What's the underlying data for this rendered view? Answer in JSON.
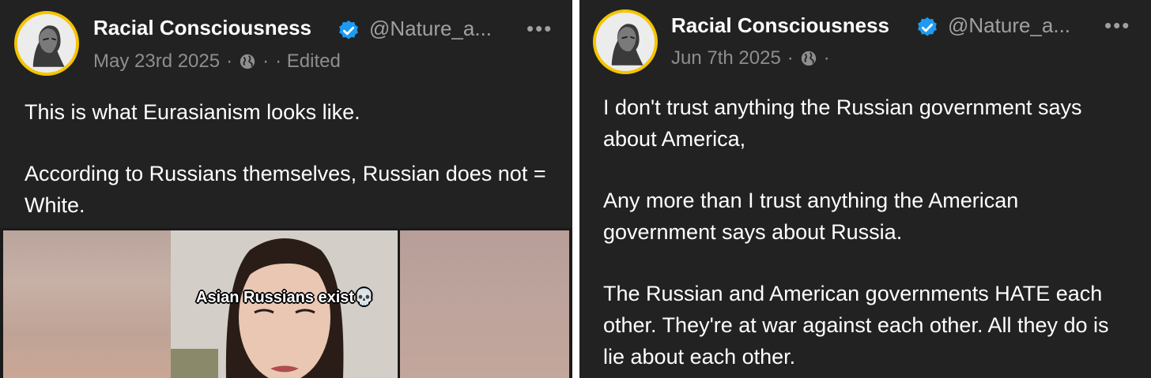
{
  "left_post": {
    "author_name": "Racial Consciousness",
    "handle": "@Nature_a...",
    "more_label": "•••",
    "date": "May 23rd 2025",
    "separator": "·",
    "edited_label": "· Edited",
    "paragraphs": [
      "This is what Eurasianism looks like.",
      "According to Russians themselves, Russian does not = White."
    ],
    "media_caption": "Asian Russians exist💀"
  },
  "right_post": {
    "author_name": "Racial Consciousness",
    "handle": "@Nature_a...",
    "more_label": "•••",
    "date": "Jun 7th 2025",
    "separator": "·",
    "paragraphs": [
      "I don't trust anything the Russian government says about America,",
      "Any more than I trust anything the American government says about Russia.",
      "The Russian and American governments HATE each other. They're at war against each other. All they do is lie about each other."
    ]
  },
  "colors": {
    "background": "#222222",
    "avatar_ring": "#f5c400",
    "verified_badge": "#1d9bf0",
    "muted_text": "#8e8e8e"
  },
  "icons": {
    "verified": "verified-badge-icon",
    "globe": "globe-icon",
    "more": "more-options-icon"
  }
}
